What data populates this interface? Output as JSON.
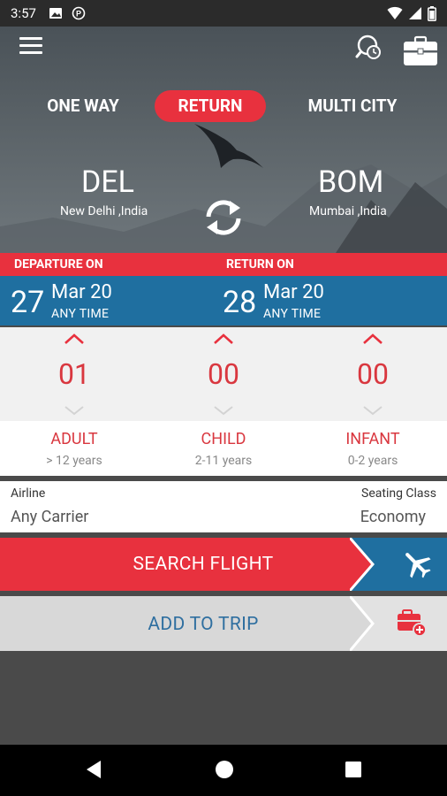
{
  "status": {
    "time": "3:57"
  },
  "trip_types": {
    "one_way": "ONE WAY",
    "return": "RETURN",
    "multi_city": "MULTI CITY",
    "selected": "RETURN"
  },
  "route": {
    "from_code": "DEL",
    "from_city": "New Delhi ,India",
    "to_code": "BOM",
    "to_city": "Mumbai ,India"
  },
  "dates": {
    "departure_label": "DEPARTURE ON",
    "return_label": "RETURN ON",
    "departure": {
      "day": "27",
      "month_year": "Mar 20",
      "time": "ANY TIME"
    },
    "return": {
      "day": "28",
      "month_year": "Mar 20",
      "time": "ANY TIME"
    }
  },
  "passengers": [
    {
      "count": "01",
      "label": "ADULT",
      "range": "> 12 years"
    },
    {
      "count": "00",
      "label": "CHILD",
      "range": "2-11 years"
    },
    {
      "count": "00",
      "label": "INFANT",
      "range": "0-2 years"
    }
  ],
  "airline": {
    "label": "Airline",
    "value": "Any Carrier"
  },
  "seating": {
    "label": "Seating Class",
    "value": "Economy"
  },
  "buttons": {
    "search": "SEARCH FLIGHT",
    "add_trip": "ADD TO TRIP"
  },
  "colors": {
    "accent_red": "#e8313e",
    "primary_blue": "#1f6fa0"
  }
}
